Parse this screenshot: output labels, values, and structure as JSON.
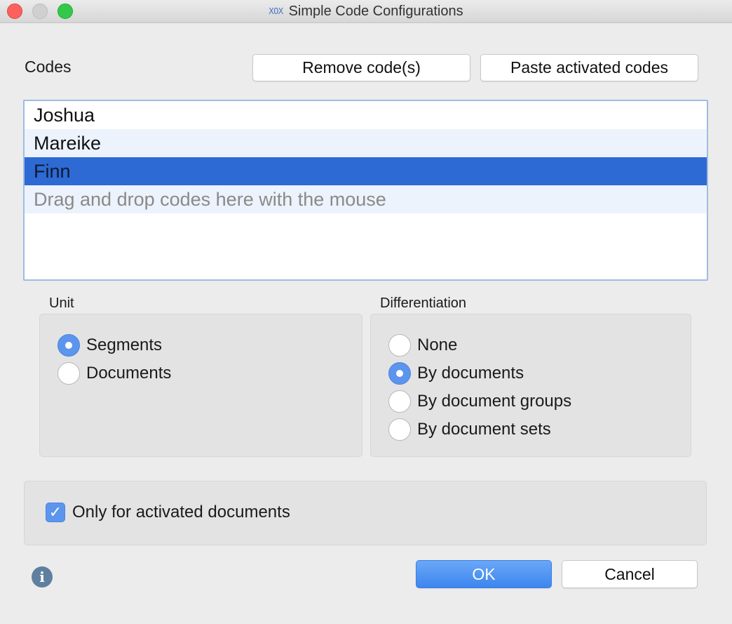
{
  "window": {
    "app_icon": "XOX",
    "title": "Simple Code Configurations"
  },
  "codes": {
    "label": "Codes",
    "remove_label": "Remove code(s)",
    "paste_label": "Paste activated codes",
    "items": [
      {
        "label": "Joshua",
        "selected": false
      },
      {
        "label": "Mareike",
        "selected": false
      },
      {
        "label": "Finn",
        "selected": true
      }
    ],
    "placeholder": "Drag and drop codes here with the mouse"
  },
  "unit": {
    "label": "Unit",
    "options": [
      "Segments",
      "Documents"
    ],
    "selected": "Segments"
  },
  "differentiation": {
    "label": "Differentiation",
    "options": [
      "None",
      "By documents",
      "By document groups",
      "By document sets"
    ],
    "selected": "By documents"
  },
  "options": {
    "activated_only_label": "Only for activated documents",
    "activated_only_checked": true
  },
  "footer": {
    "info_icon": "info-icon",
    "ok_label": "OK",
    "cancel_label": "Cancel"
  },
  "colors": {
    "selection": "#2d6ad3",
    "accent": "#5b95ee",
    "ok_button": "#4a90f0"
  }
}
